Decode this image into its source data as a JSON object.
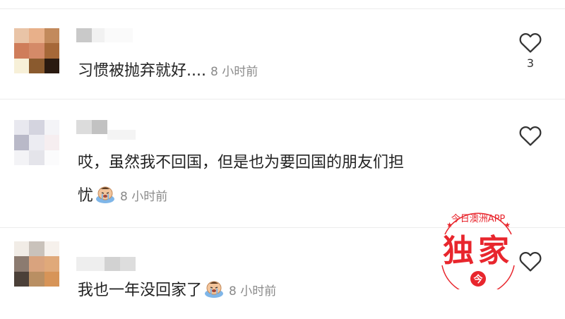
{
  "comments": [
    {
      "text": "习惯被抛弃就好....",
      "time": "8 小时前",
      "likes": "3",
      "has_emoji": false
    },
    {
      "text_line1": "哎，虽然我不回国，但是也为要回国的朋友们担",
      "text_line2": "忧",
      "time": "8 小时前",
      "has_emoji": true
    },
    {
      "text": "我也一年没回家了",
      "time": "8 小时前",
      "has_emoji": true
    }
  ],
  "watermark": {
    "top_text": "今日澳洲APP",
    "main_text": "独家",
    "logo_char": "今"
  },
  "colors": {
    "watermark_red": "#e8262d",
    "time_gray": "#8a8a8a"
  },
  "icons": [
    "heart-outline-icon",
    "crying-emoji-icon"
  ]
}
